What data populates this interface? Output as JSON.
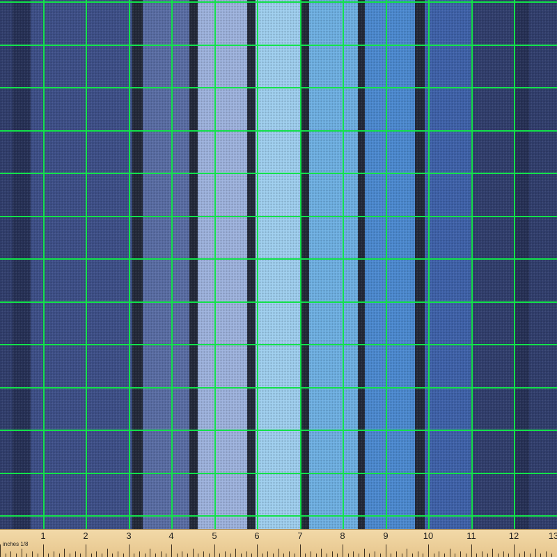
{
  "ruler": {
    "unit_label": "inches 1/8",
    "numbers": [
      "1",
      "2",
      "3",
      "4",
      "5",
      "6",
      "7",
      "8",
      "9",
      "10",
      "11",
      "12",
      "13"
    ]
  },
  "colors": {
    "navy": "#323f6e",
    "dark_blue": "#3e5089",
    "slate_blue": "#5a6ea5",
    "periwinkle": "#9eb3de",
    "light_blue": "#9fcfef",
    "sky_blue": "#6fb0e3",
    "medium_blue": "#4c8ad1",
    "royal_blue": "#3f62aa",
    "stripe_dark": "#242a3a",
    "grid_line": "#12e24a",
    "ruler_wood": "#efd39e"
  }
}
